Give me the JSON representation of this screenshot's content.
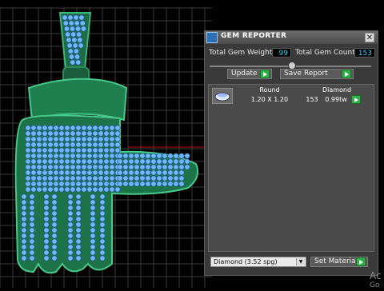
{
  "panel": {
    "title": "GEM REPORTER",
    "close_label": "✕",
    "total_gem_weight_label": "Total Gem Weight",
    "total_gem_weight_value": "99",
    "total_gem_count_label": "Total Gem Count",
    "total_gem_count_value": "153",
    "update_label": "Update",
    "save_report_label": "Save Report",
    "table": {
      "headers": [
        "Round",
        "Diamond"
      ],
      "row": {
        "size": "1.20 X 1.20",
        "count": "153",
        "weight": "0.99tw"
      }
    },
    "material_select": "Diamond    (3.52 spg)",
    "set_material_label": "Set Material"
  },
  "corner": {
    "line1": "Ac",
    "line2": "Go"
  },
  "colors": {
    "gem": "#6fb8ff",
    "metal": "#1f7f4e",
    "accent": "#32d3ff",
    "grid": "#3a3a3a"
  }
}
